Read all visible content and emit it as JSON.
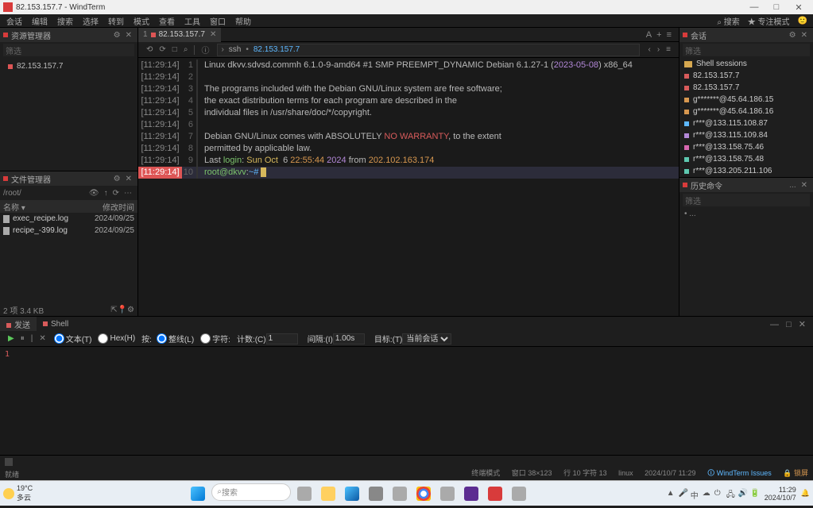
{
  "titlebar": {
    "title": "82.153.157.7 - WindTerm",
    "min": "—",
    "max": "□",
    "close": "✕"
  },
  "menubar": {
    "items": [
      "会话",
      "编辑",
      "搜索",
      "选择",
      "转到",
      "模式",
      "查看",
      "工具",
      "窗口",
      "帮助"
    ],
    "right": {
      "search": "⌕  搜索",
      "focus": "★ 专注模式",
      "user": "🙂"
    }
  },
  "res_panel": {
    "title": "资源管理器",
    "filter": "筛选",
    "item": "82.153.157.7",
    "settings": "⚙",
    "close": "✕"
  },
  "file_panel": {
    "title": "文件管理器",
    "path": "/root/",
    "eye": "👁",
    "up": "↑",
    "refresh": "⟳",
    "more": "⋯",
    "col_name": "名称",
    "col_mod": "修改时间",
    "rows": [
      {
        "name": "exec_recipe.log",
        "date": "2024/09/25"
      },
      {
        "name": "recipe_-399.log",
        "date": "2024/09/25"
      }
    ],
    "status": "2 项  3.4 KB",
    "btn1": "⇱",
    "btn2": "📍",
    "btn3": "⚙"
  },
  "tab": {
    "num": "1",
    "name": "82.153.157.7",
    "close": "✕",
    "a": "A",
    "plus": "+",
    "lines": "≡"
  },
  "toolbar": {
    "b1": "⟲",
    "b2": "⟳",
    "b3": "□",
    "b4": "⌕",
    "sep": "|",
    "info": "ⓘ",
    "arrow": "›",
    "ssh": "ssh",
    "dot": "•",
    "ip": "82.153.157.7",
    "left": "‹",
    "right": "›",
    "menu": "≡"
  },
  "term": {
    "lines": [
      {
        "ts": "[11:29:14]",
        "ln": "1",
        "type": "l1"
      },
      {
        "ts": "[11:29:14]",
        "ln": "2",
        "txt": ""
      },
      {
        "ts": "[11:29:14]",
        "ln": "3",
        "txt": "The programs included with the Debian GNU/Linux system are free software;"
      },
      {
        "ts": "[11:29:14]",
        "ln": "4",
        "txt": "the exact distribution terms for each program are described in the"
      },
      {
        "ts": "[11:29:14]",
        "ln": "5",
        "txt": "individual files in /usr/share/doc/*/copyright."
      },
      {
        "ts": "[11:29:14]",
        "ln": "6",
        "txt": ""
      },
      {
        "ts": "[11:29:14]",
        "ln": "7",
        "type": "l7"
      },
      {
        "ts": "[11:29:14]",
        "ln": "8",
        "txt": "permitted by applicable law."
      },
      {
        "ts": "[11:29:14]",
        "ln": "9",
        "type": "l9"
      },
      {
        "ts": "[11:29:14]",
        "ln": "10",
        "type": "l10",
        "cur": true
      }
    ],
    "l1": {
      "a": "Linux dkvv.sdvsd.commh 6.1.0-9-amd64 #1 SMP PREEMPT_DYNAMIC Debian 6.1.27-1 (",
      "b": "2023-05-08",
      "c": ") x86_64"
    },
    "l7": {
      "a": "Debian GNU/Linux comes with ABSOLUTELY ",
      "b": "NO WARRANTY",
      "c": ", to the extent"
    },
    "l9": {
      "a": "Last ",
      "b": "login",
      "c": ": ",
      "d": "Sun Oct",
      "e": "  6 ",
      "f": "22:55:44",
      "g": " ",
      "h": "2024",
      "i": " from ",
      "j": "202.102.163.174"
    },
    "l10": {
      "a": "root@dkvv",
      "b": ":",
      "c": "~#",
      "d": " "
    }
  },
  "sess": {
    "title": "会话",
    "filter": "筛选",
    "settings": "⚙",
    "close": "✕",
    "folder": "Shell sessions",
    "items": [
      {
        "name": "82.153.157.7",
        "dot": "dot-red"
      },
      {
        "name": "82.153.157.7",
        "dot": "dot-red"
      },
      {
        "name": "g*******@45.64.186.15",
        "dot": "dot-orange"
      },
      {
        "name": "g*******@45.64.186.16",
        "dot": "dot-orange"
      },
      {
        "name": "r***@133.115.108.87",
        "dot": "dot-blue"
      },
      {
        "name": "r***@133.115.109.84",
        "dot": "dot-purple"
      },
      {
        "name": "r***@133.158.75.46",
        "dot": "dot-pink"
      },
      {
        "name": "r***@133.158.75.48",
        "dot": "dot-teal"
      },
      {
        "name": "r***@133.205.211.106",
        "dot": "dot-teal"
      }
    ]
  },
  "hist": {
    "title": "历史命令",
    "filter": "筛选",
    "dots": "• ...",
    "more": "...",
    "close": "✕"
  },
  "send": {
    "tab1": "发送",
    "tab2": "Shell",
    "play": "▶",
    "pause": "⏸",
    "sep": "|",
    "x": "✕",
    "text": "文本(T)",
    "hex": "Hex(H)",
    "by": "按:",
    "line": "整线(L)",
    "char": "字符:",
    "count": "计数:(C)",
    "count_v": "1",
    "interval": "间隔:(I)",
    "interval_v": "1.00s",
    "target": "目标:(T)",
    "target_v": "当前会话",
    "min": "—",
    "max": "□",
    "close": "✕",
    "body": "1"
  },
  "status": {
    "s2_left": "就绪",
    "s2_mode": "终端模式",
    "s2_win": "窗口 38×123",
    "s2_pos": "行 10 字符 13",
    "s2_os": "linux",
    "s2_time": "2024/10/7 11:29",
    "s2_issues": "🛈 WindTerm Issues",
    "s2_lock": "🔒 锁屏"
  },
  "taskbar": {
    "temp": "19°C",
    "weather": "多云",
    "search": "搜索",
    "time": "11:29",
    "date": "2024/10/7",
    "tray": [
      "▲",
      "🎤",
      "中",
      "☁",
      "⏻",
      "🖧",
      "🔊",
      "🔋"
    ],
    "bell": "🔔"
  }
}
